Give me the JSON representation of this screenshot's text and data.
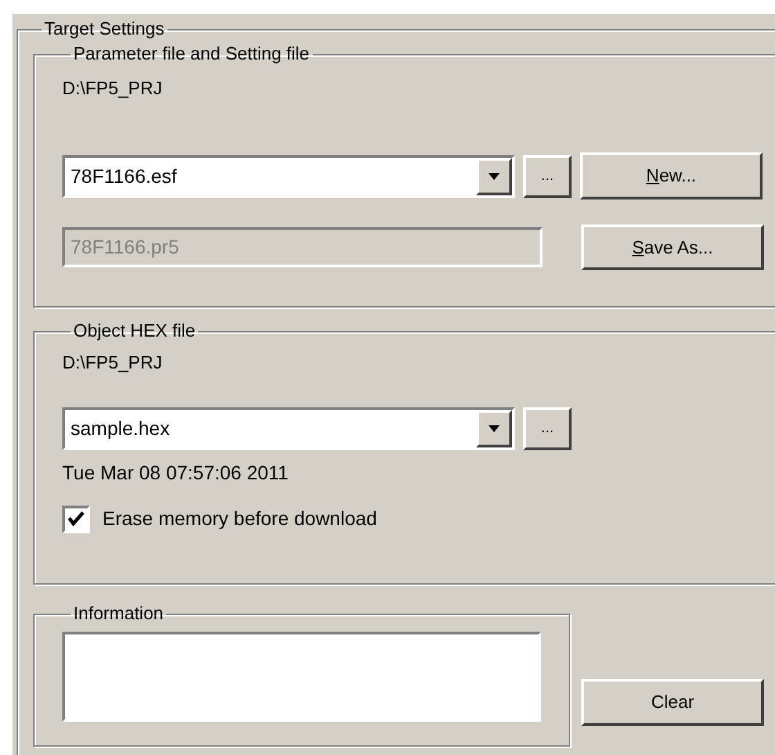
{
  "target_settings": {
    "title": "Target Settings",
    "parameter_group": {
      "title": "Parameter file and Setting file",
      "path": "D:\\FP5_PRJ",
      "parameter_combo": {
        "value": "78F1166.esf"
      },
      "setting_field": {
        "value": "78F1166.pr5",
        "disabled": true
      },
      "browse_button": {
        "label": "..."
      },
      "buttons": [
        {
          "label": "New...",
          "first_letter_underlined": true
        },
        {
          "label": "Save As...",
          "first_letter_underlined": true
        }
      ]
    },
    "hex_group": {
      "title": "Object HEX file",
      "path": "D:\\FP5_PRJ",
      "hex_combo": {
        "value": "sample.hex"
      },
      "browse_button": {
        "label": "..."
      },
      "timestamp": "Tue Mar 08 07:57:06 2011",
      "erase_checkbox": {
        "label": "Erase memory before download",
        "checked": true
      }
    },
    "information_group": {
      "title": "Information"
    },
    "clear_button": {
      "label": "Clear"
    }
  }
}
